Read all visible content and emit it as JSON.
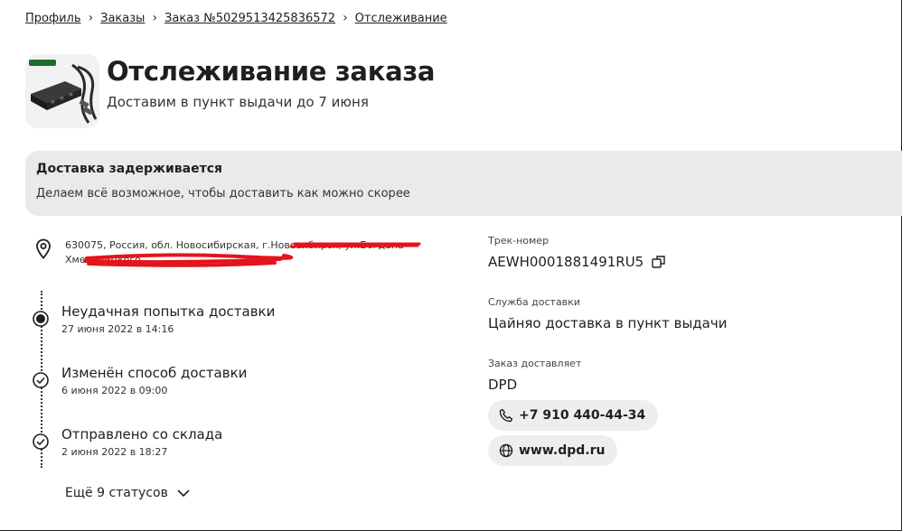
{
  "breadcrumb": {
    "items": [
      "Профиль",
      "Заказы",
      "Заказ №5029513425836572",
      "Отслеживание"
    ],
    "separator": "›"
  },
  "header": {
    "title": "Отслеживание заказа",
    "subtitle": "Доставим в пункт выдачи до 7 июня"
  },
  "alert": {
    "title": "Доставка задерживается",
    "text": "Делаем всё возможное, чтобы доставить как можно скорее"
  },
  "address": {
    "text": "630075, Россия, обл. Новосибирская, г.Новосибирск, ул.Богдана Хмельницкого"
  },
  "timeline": {
    "items": [
      {
        "title": "Неудачная попытка доставки",
        "date": "27 июня 2022 в 14:16",
        "state": "current"
      },
      {
        "title": "Изменён способ доставки",
        "date": "6 июня 2022 в 09:00",
        "state": "done"
      },
      {
        "title": "Отправлено со склада",
        "date": "2 июня 2022 в 18:27",
        "state": "done"
      }
    ],
    "more_label": "Ещё 9 статусов"
  },
  "details": {
    "track_label": "Трек-номер",
    "track_value": "AEWH0001881491RU5",
    "service_label": "Служба доставки",
    "service_value": "Цайняо доставка в пункт выдачи",
    "carrier_label": "Заказ доставляет",
    "carrier_value": "DPD",
    "phone": "+7 910 440-44-34",
    "website": "www.dpd.ru"
  },
  "colors": {
    "alert_bg": "#eaeaea",
    "chip_bg": "#eeeeee",
    "redaction": "#e3141b"
  }
}
